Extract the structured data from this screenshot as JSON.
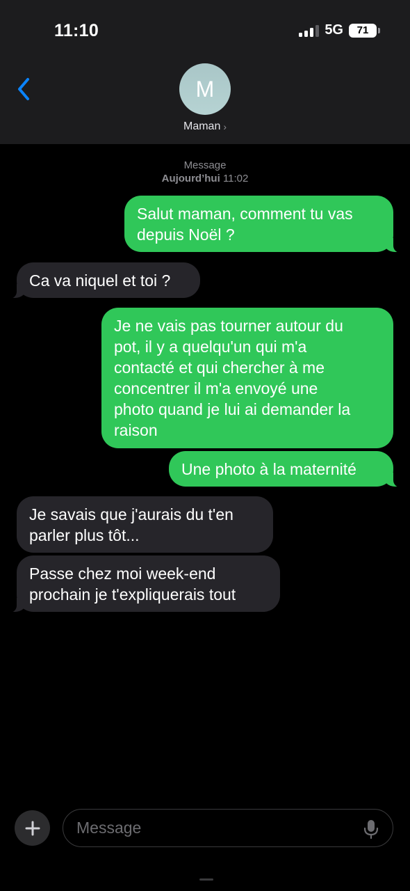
{
  "status_bar": {
    "time": "11:10",
    "network": "5G",
    "battery": "71"
  },
  "header": {
    "avatar_initial": "M",
    "contact_name": "Maman",
    "contact_chevron": "›"
  },
  "thread": {
    "service_label": "Message",
    "timestamp_day": "Aujourd’hui",
    "timestamp_time": "11:02",
    "messages": [
      {
        "from": "me",
        "text": "Salut maman, comment tu vas\ndepuis Noël ?"
      },
      {
        "from": "them",
        "text": "Ca va niquel et toi ?"
      },
      {
        "from": "me",
        "text": "Je ne vais pas tourner autour du\npot, il y a quelqu'un qui m'a\ncontacté et qui chercher à me\nconcentrer il m'a envoyé une\nphoto quand je lui ai demander la\nraison"
      },
      {
        "from": "me",
        "text": "Une photo à la maternité"
      },
      {
        "from": "them",
        "text": "Je savais que j'aurais du t'en\nparler plus tôt..."
      },
      {
        "from": "them",
        "text": "Passe chez moi week-end\nprochain je t'expliquerais tout"
      }
    ]
  },
  "composer": {
    "placeholder": "Message"
  },
  "colors": {
    "outgoing": "#30c759",
    "incoming": "#26252a",
    "accent": "#0a84ff",
    "header_bg": "#1c1c1e"
  },
  "icons": {
    "back": "chevron-left-icon",
    "add": "plus-icon",
    "mic": "microphone-icon"
  }
}
